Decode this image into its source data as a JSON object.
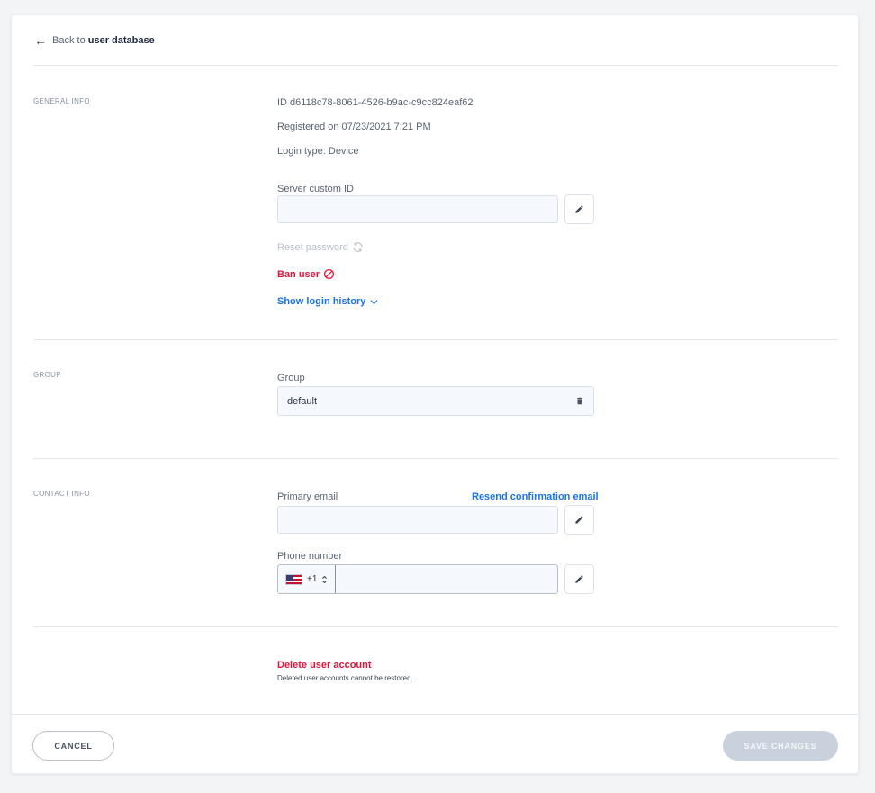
{
  "header": {
    "back_prefix": "Back to",
    "back_target": "user database"
  },
  "general": {
    "section_label": "GENERAL INFO",
    "id_line": "ID d6118c78-8061-4526-b9ac-c9cc824eaf62",
    "registered_line": "Registered on 07/23/2021 7:21 PM",
    "login_type_line": "Login type: Device",
    "server_custom_id_label": "Server custom ID",
    "server_custom_id_value": "",
    "reset_password": "Reset password",
    "ban_user": "Ban user",
    "show_login_history": "Show login history"
  },
  "group": {
    "section_label": "GROUP",
    "field_label": "Group",
    "value": "default"
  },
  "contact": {
    "section_label": "CONTACT INFO",
    "primary_email_label": "Primary email",
    "resend_link": "Resend confirmation email",
    "primary_email_value": "",
    "phone_label": "Phone number",
    "country_code": "+1",
    "phone_value": ""
  },
  "danger": {
    "delete_title": "Delete user account",
    "delete_note": "Deleted user accounts cannot be restored."
  },
  "footer": {
    "cancel_label": "CANCEL",
    "save_label": "SAVE CHANGES"
  },
  "colors": {
    "danger": "#e5133a",
    "link": "#1a73e8",
    "disabled_button": "#c9d1dc"
  },
  "icons": {
    "back": "arrow-left-icon",
    "edit": "pencil-icon",
    "reset": "refresh-icon",
    "ban": "ban-icon",
    "expand": "chevron-down-icon",
    "delete": "trash-icon",
    "flag": "us-flag-icon",
    "select": "select-arrows-icon"
  }
}
